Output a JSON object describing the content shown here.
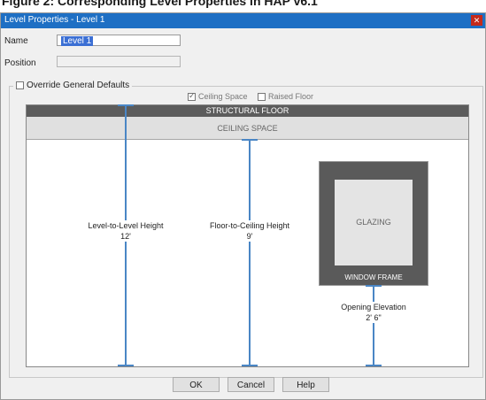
{
  "caption": "Figure 2: Corresponding Level Properties in HAP v6.1",
  "window": {
    "title": "Level Properties - Level 1",
    "close_glyph": "✕"
  },
  "form": {
    "name_label": "Name",
    "name_value": "Level 1",
    "position_label": "Position",
    "position_value": ""
  },
  "group": {
    "label": "Override General Defaults",
    "override_checked": false,
    "ceiling_space_label": "Ceiling Space",
    "ceiling_space_checked": true,
    "raised_floor_label": "Raised Floor",
    "raised_floor_checked": false
  },
  "diagram": {
    "structural_floor": "STRUCTURAL FLOOR",
    "ceiling_space": "CEILING SPACE",
    "level_height_label": "Level-to-Level Height",
    "level_height_value": "12'",
    "floor_ceiling_label": "Floor-to-Ceiling Height",
    "floor_ceiling_value": "9'",
    "glazing": "GLAZING",
    "window_frame": "WINDOW FRAME",
    "opening_elev_label": "Opening Elevation",
    "opening_elev_value": "2' 6\"",
    "accent_color": "#4a86c5"
  },
  "buttons": {
    "ok": "OK",
    "cancel": "Cancel",
    "help": "Help"
  }
}
